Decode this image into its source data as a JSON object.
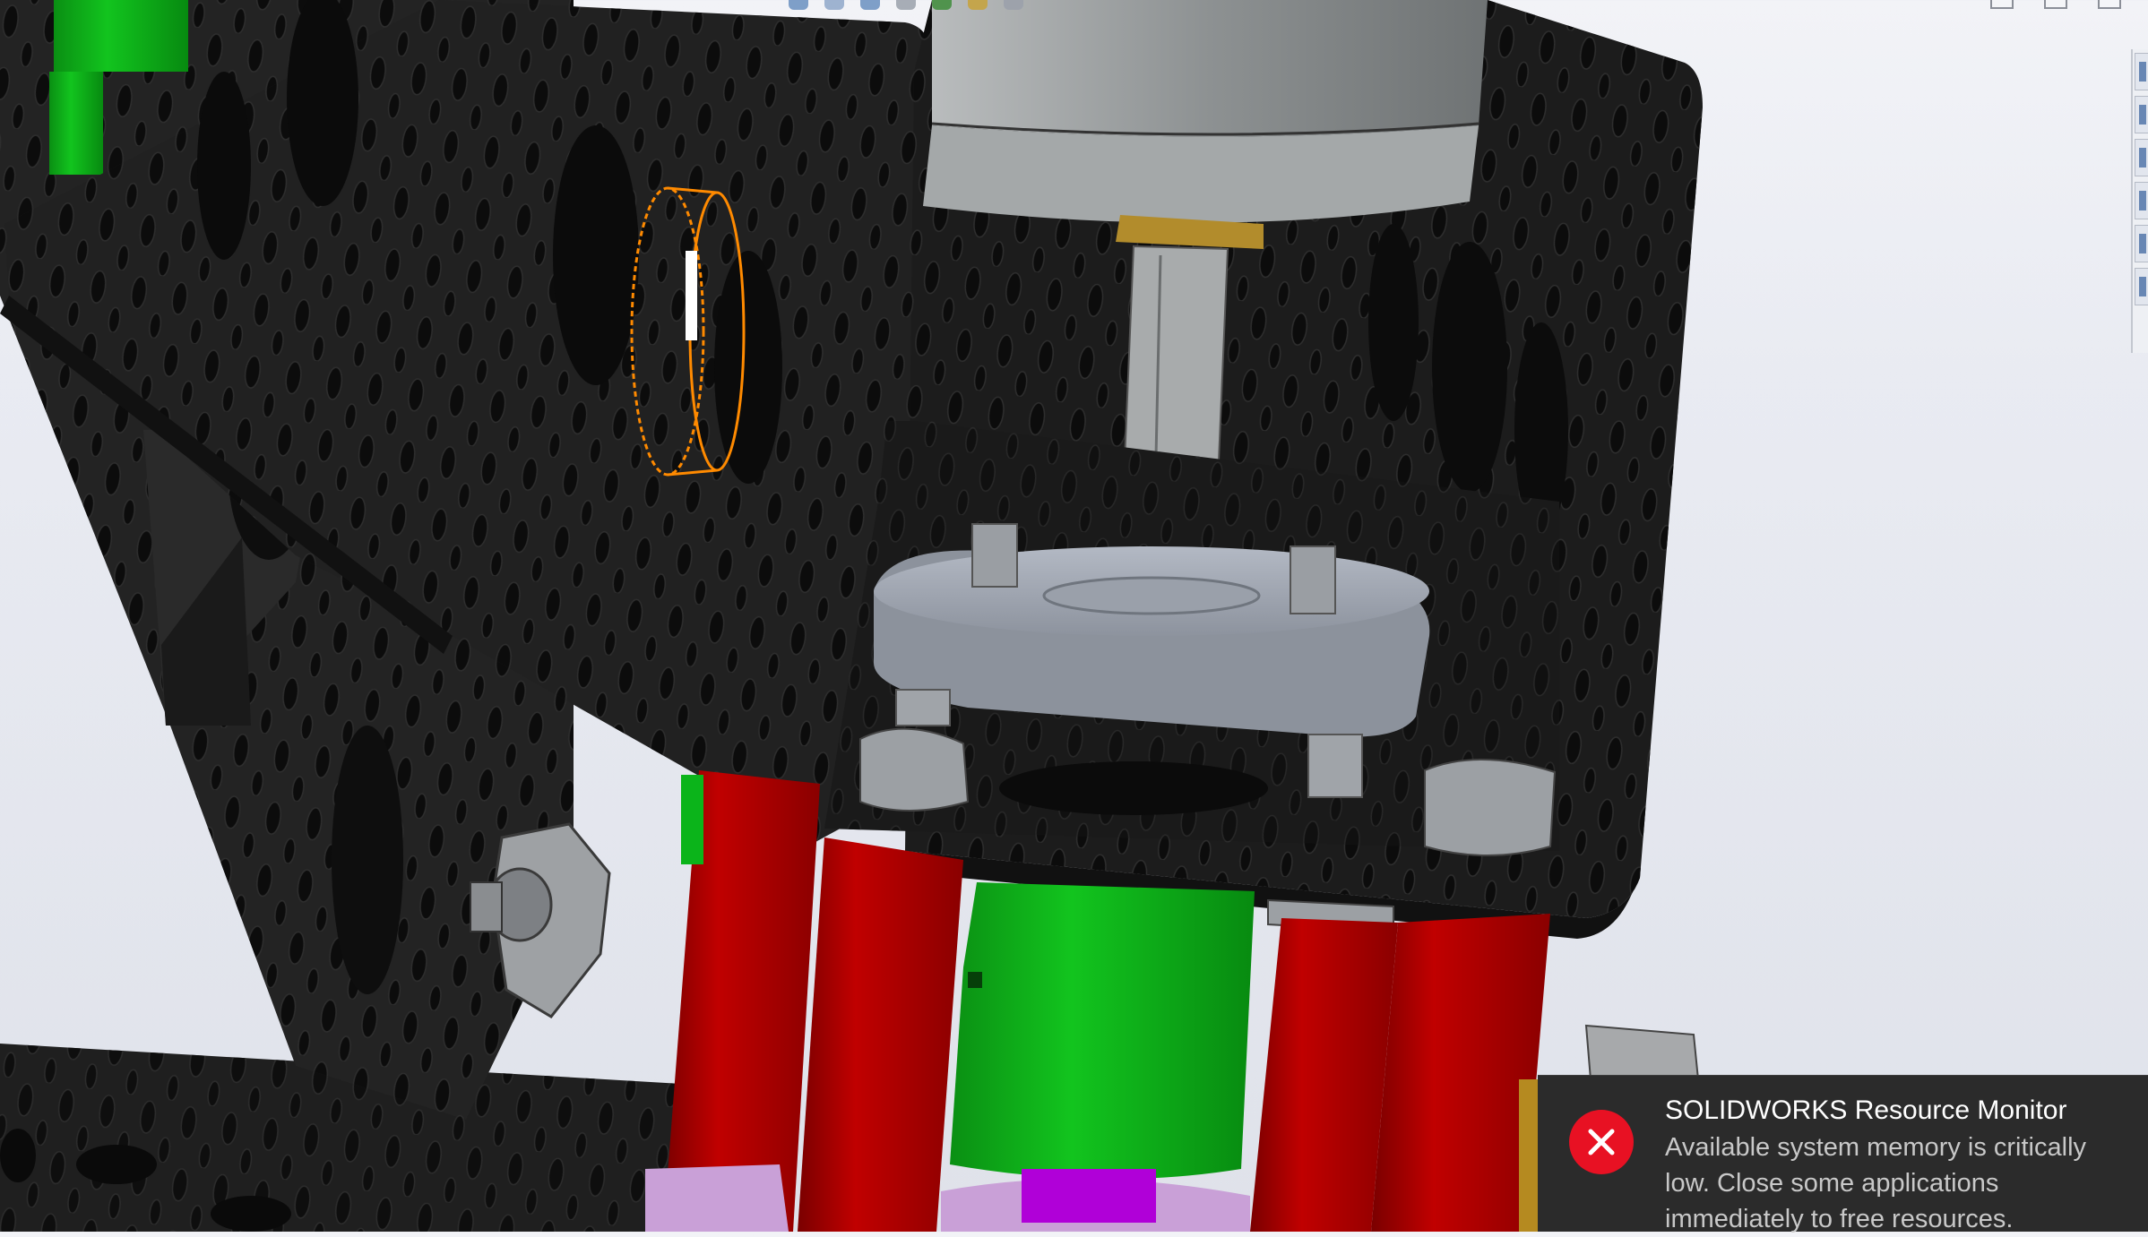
{
  "app": {
    "name": "SOLIDWORKS",
    "heads_up_toolbar": [
      "view-orientation-icon",
      "display-style-icon",
      "section-view-icon",
      "hide-show-icon",
      "appearance-icon",
      "scene-icon",
      "view-settings-icon"
    ],
    "window_controls": [
      "minimize-icon",
      "restore-icon",
      "close-icon"
    ],
    "task_pane_tabs": [
      "resources-icon",
      "design-library-icon",
      "file-explorer-icon",
      "view-palette-icon",
      "appearances-icon",
      "custom-properties-icon"
    ]
  },
  "colors": {
    "viewport_background": "#e6e8ef",
    "bracket_black": "#1e1e1e",
    "red_standoff": "#b00000",
    "green_coupler": "#0bb41a",
    "magenta_shaft": "#b000d8",
    "selection_orange": "#ff8a00",
    "toast_background": "#2b2b2b",
    "error_red": "#e81123"
  },
  "notification": {
    "title": "SOLIDWORKS Resource Monitor",
    "message": "Available system memory is critically low. Close some applications immediately to free resources.",
    "icon": "error-circle-icon"
  }
}
